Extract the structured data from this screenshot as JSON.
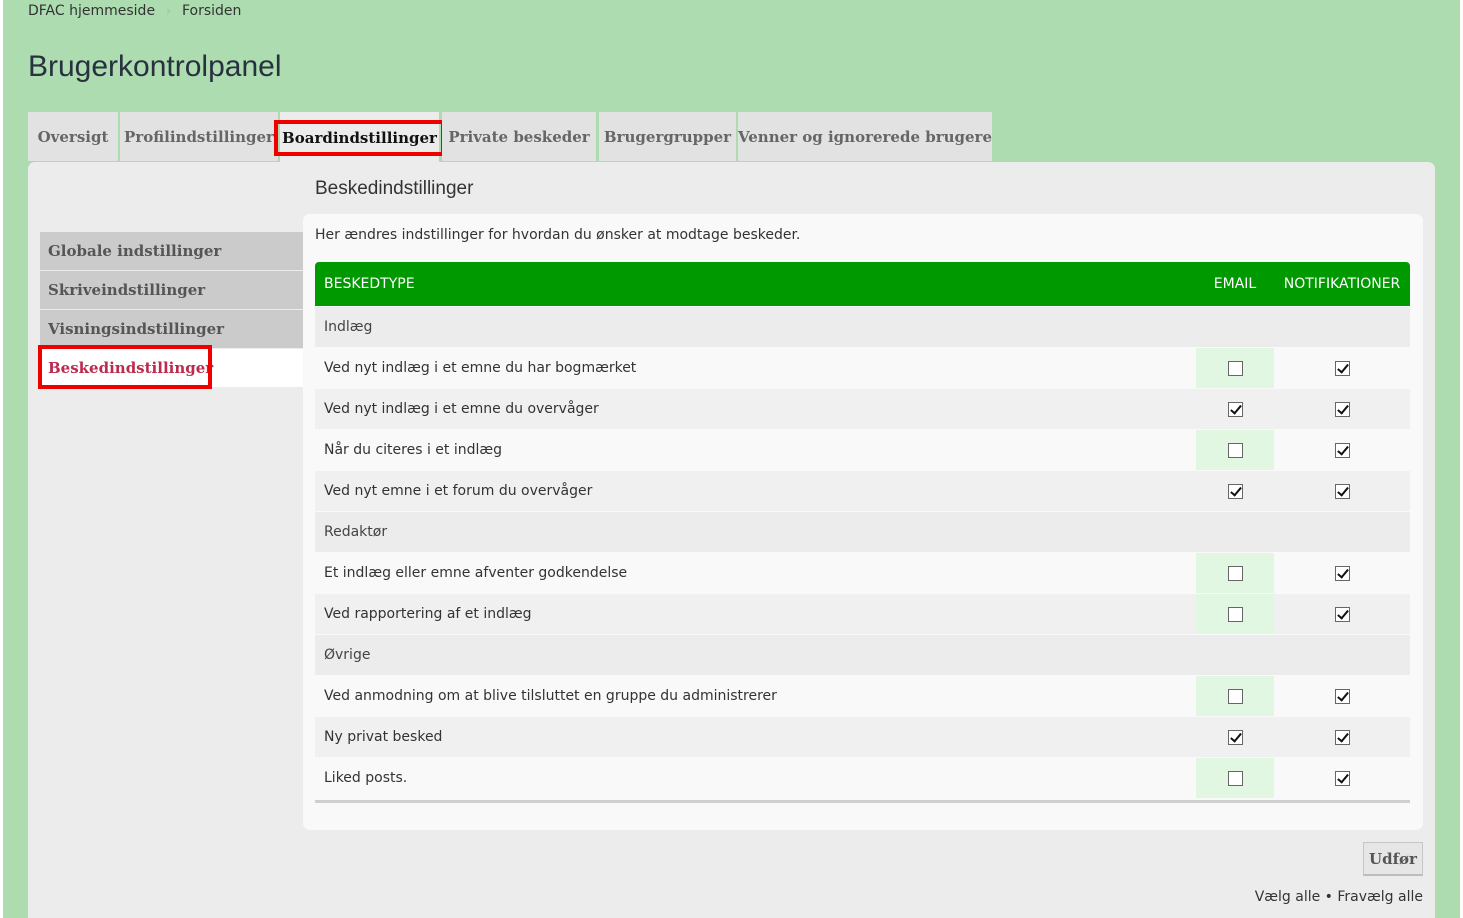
{
  "breadcrumbs": [
    "DFAC hjemmeside",
    "Forsiden"
  ],
  "page_title": "Brugerkontrolpanel",
  "tabs": [
    {
      "label": "Oversigt",
      "active": false
    },
    {
      "label": "Profilindstillinger",
      "active": false
    },
    {
      "label": "Boardindstillinger",
      "active": true
    },
    {
      "label": "Private beskeder",
      "active": false
    },
    {
      "label": "Brugergrupper",
      "active": false
    },
    {
      "label": "Venner og ignorerede brugere",
      "active": false
    }
  ],
  "sidebar": {
    "items": [
      {
        "label": "Globale indstillinger",
        "active": false
      },
      {
        "label": "Skriveindstillinger",
        "active": false
      },
      {
        "label": "Visningsindstillinger",
        "active": false
      },
      {
        "label": "Beskedindstillinger",
        "active": true
      }
    ]
  },
  "section_title": "Beskedindstillinger",
  "intro": "Her ændres indstillinger for hvordan du ønsker at modtage beskeder.",
  "table": {
    "headers": [
      "BESKEDTYPE",
      "EMAIL",
      "NOTIFIKATIONER"
    ],
    "rows": [
      {
        "type": "group",
        "label": "Indlæg"
      },
      {
        "type": "item",
        "label": "Ved nyt indlæg i et emne du har bogmærket",
        "email": false,
        "notif": true
      },
      {
        "type": "item",
        "label": "Ved nyt indlæg i et emne du overvåger",
        "email": true,
        "notif": true
      },
      {
        "type": "item",
        "label": "Når du citeres i et indlæg",
        "email": false,
        "notif": true
      },
      {
        "type": "item",
        "label": "Ved nyt emne i et forum du overvåger",
        "email": true,
        "notif": true
      },
      {
        "type": "group",
        "label": "Redaktør"
      },
      {
        "type": "item",
        "label": "Et indlæg eller emne afventer godkendelse",
        "email": false,
        "notif": true
      },
      {
        "type": "item",
        "label": "Ved rapportering af et indlæg",
        "email": false,
        "notif": true
      },
      {
        "type": "group",
        "label": "Øvrige"
      },
      {
        "type": "item",
        "label": "Ved anmodning om at blive tilsluttet en gruppe du administrerer",
        "email": false,
        "notif": true
      },
      {
        "type": "item",
        "label": "Ny privat besked",
        "email": true,
        "notif": true
      },
      {
        "type": "item",
        "label": "Liked posts.",
        "email": false,
        "notif": true
      }
    ]
  },
  "submit_label": "Udfør",
  "select_all": "Vælg alle",
  "select_sep": "•",
  "deselect_all": "Fravælg alle",
  "colors": {
    "background": "#acdcaf",
    "header_green": "#009900",
    "highlight": "#ee0000",
    "active_link": "#bc2a4d"
  }
}
